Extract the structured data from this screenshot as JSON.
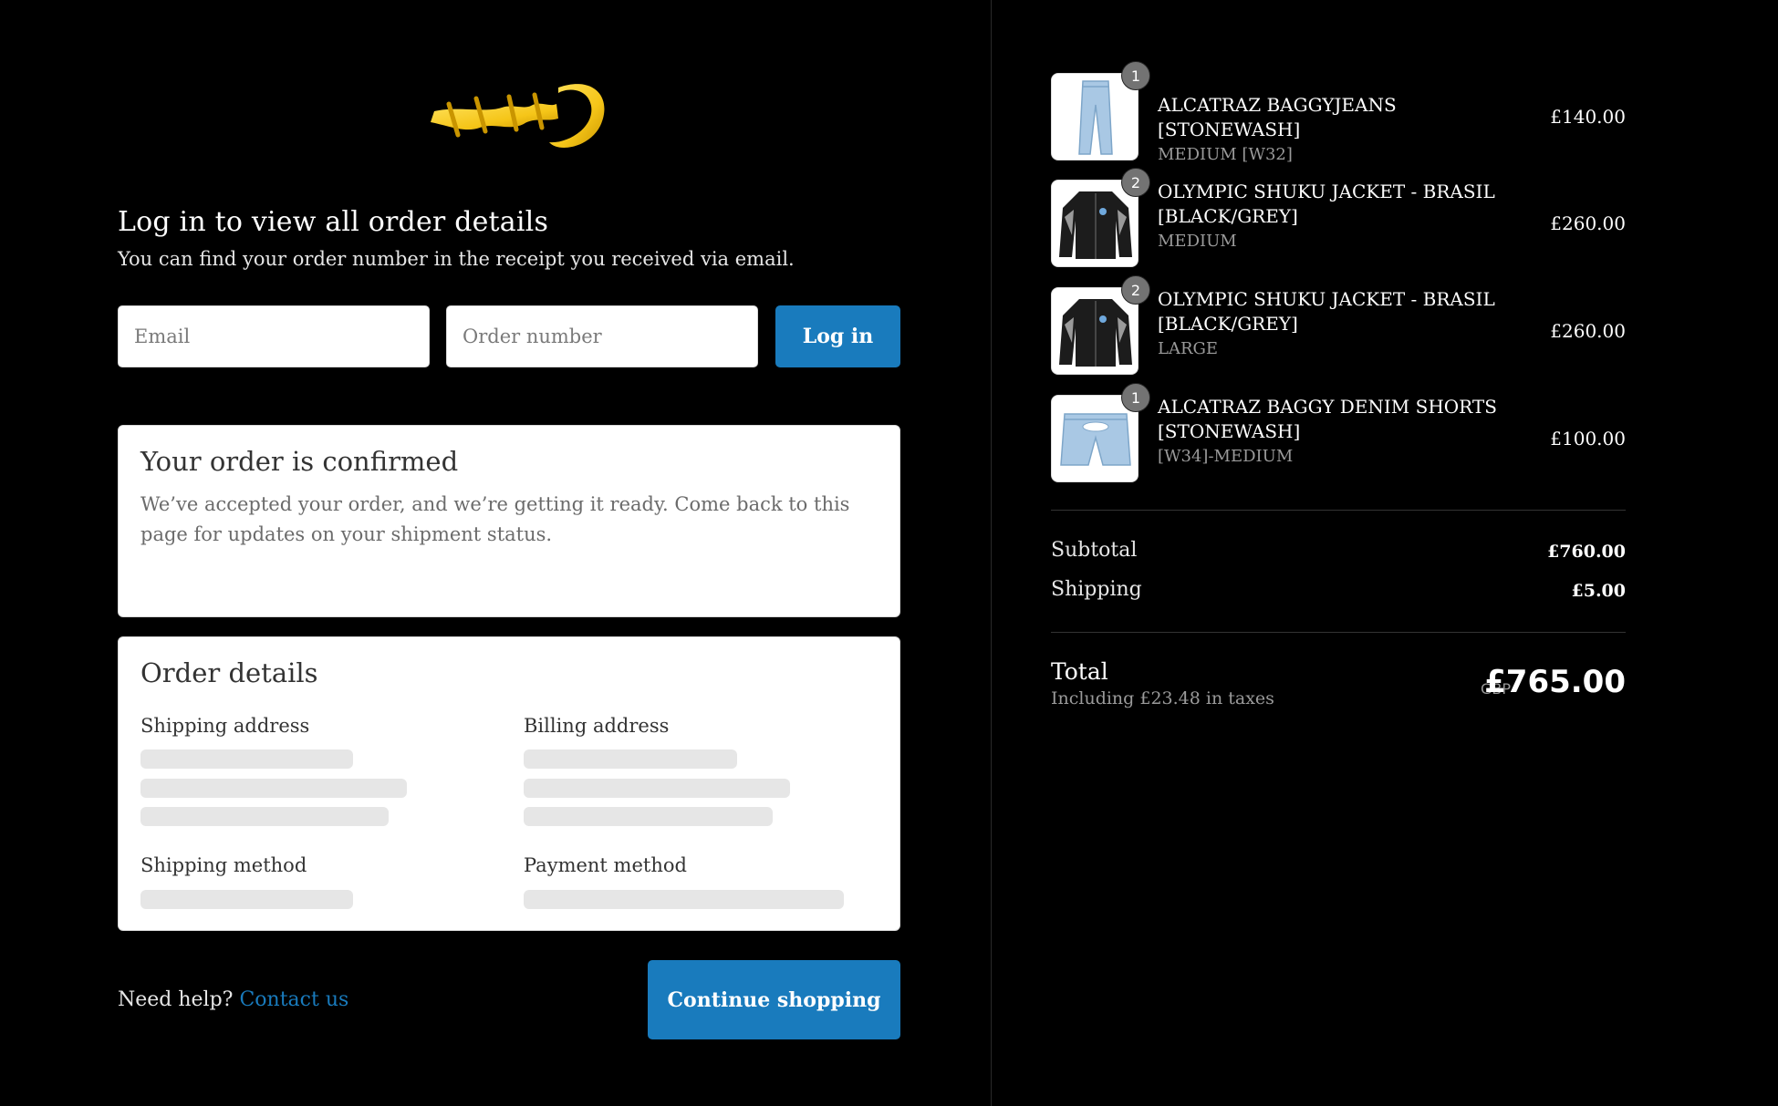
{
  "brand": {
    "logo_text": "Corteiz",
    "logo_color": "#f5c518"
  },
  "login": {
    "title": "Log in to view all order details",
    "subtitle": "You can find your order number in the receipt you received via email.",
    "email_placeholder": "Email",
    "order_placeholder": "Order number",
    "button_label": "Log in"
  },
  "confirmation": {
    "title": "Your order is confirmed",
    "text": "We’ve accepted your order, and we’re getting it ready. Come back to this page for updates on your shipment status."
  },
  "order_details": {
    "title": "Order details",
    "shipping_address": "Shipping address",
    "billing_address": "Billing address",
    "shipping_method": "Shipping method",
    "payment_method": "Payment method"
  },
  "help": {
    "text": "Need help?",
    "link": "Contact us"
  },
  "continue_label": "Continue shopping",
  "cart": {
    "items": [
      {
        "name": "ALCATRAZ BAGGYJEANS [STONEWASH]",
        "variant": "MEDIUM [W32]",
        "price": "£140.00",
        "qty": "1",
        "thumb": "jeans-icon"
      },
      {
        "name": "OLYMPIC SHUKU JACKET - BRASIL [BLACK/GREY]",
        "variant": "MEDIUM",
        "price": "£260.00",
        "qty": "2",
        "thumb": "jacket-icon"
      },
      {
        "name": "OLYMPIC SHUKU JACKET - BRASIL [BLACK/GREY]",
        "variant": "LARGE",
        "price": "£260.00",
        "qty": "2",
        "thumb": "jacket-icon"
      },
      {
        "name": "ALCATRAZ BAGGY DENIM SHORTS [STONEWASH]",
        "variant": "[W34]-MEDIUM",
        "price": "£100.00",
        "qty": "1",
        "thumb": "shorts-icon"
      }
    ],
    "subtotal_label": "Subtotal",
    "subtotal": "£760.00",
    "shipping_label": "Shipping",
    "shipping": "£5.00",
    "total_label": "Total",
    "tax_note": "Including £23.48 in taxes",
    "currency": "GBP",
    "total": "£765.00"
  },
  "colors": {
    "accent": "#197bbd",
    "background": "#000000"
  }
}
